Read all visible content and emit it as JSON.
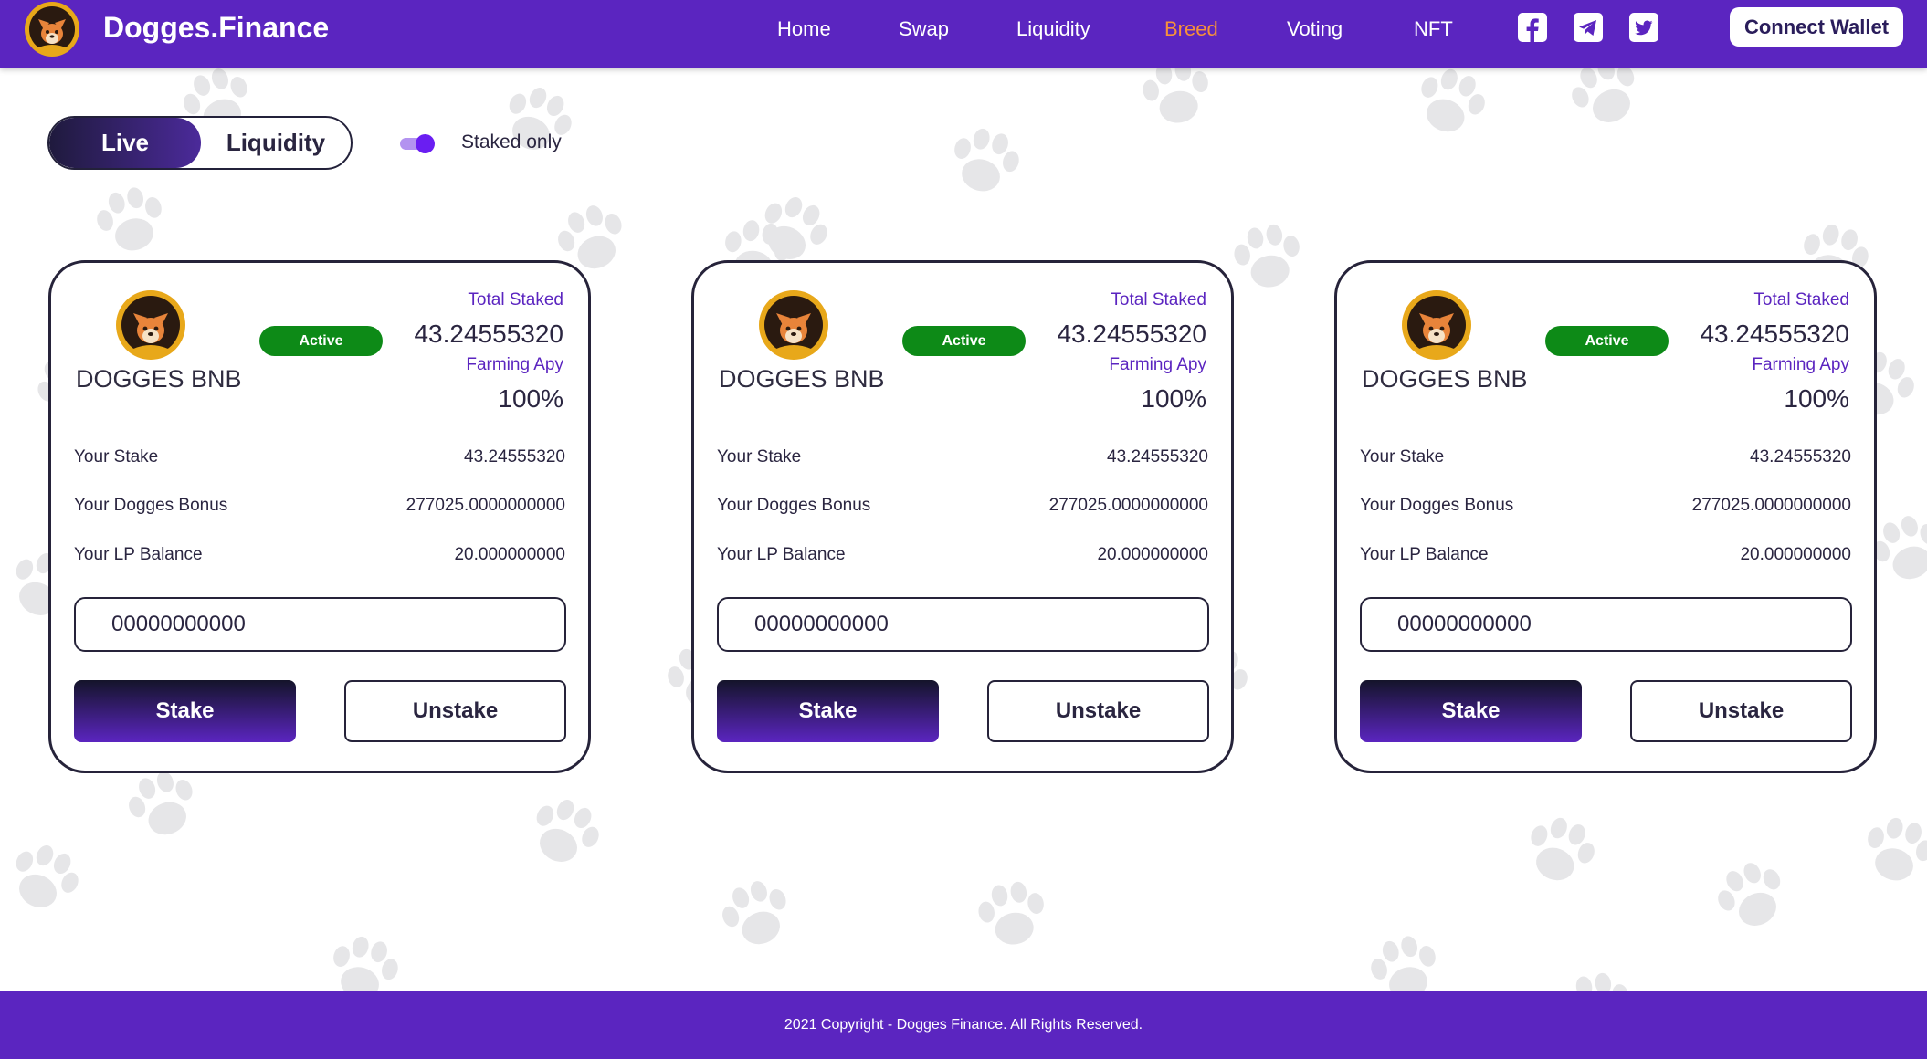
{
  "header": {
    "brand": "Dogges.Finance",
    "nav": [
      {
        "label": "Home"
      },
      {
        "label": "Swap"
      },
      {
        "label": "Liquidity"
      },
      {
        "label": "Breed"
      },
      {
        "label": "Voting"
      },
      {
        "label": "NFT"
      }
    ],
    "active_nav": "Breed",
    "social": [
      "facebook-icon",
      "telegram-icon",
      "twitter-icon"
    ],
    "connect_label": "Connect Wallet"
  },
  "filters": {
    "tabs": [
      "Live",
      "Liquidity"
    ],
    "selected_tab": "Live",
    "toggle_label": "Staked only",
    "toggle_on": true
  },
  "cards": [
    {
      "pair": "DOGGES BNB",
      "status": "Active",
      "total_staked_label": "Total Staked",
      "total_staked": "43.24555320",
      "apy_label": "Farming Apy",
      "apy": "100%",
      "rows": [
        {
          "label": "Your Stake",
          "value": "43.24555320"
        },
        {
          "label": "Your Dogges Bonus",
          "value": "277025.0000000000"
        },
        {
          "label": "Your LP Balance",
          "value": "20.000000000"
        }
      ],
      "input_value": "00000000000",
      "stake_label": "Stake",
      "unstake_label": "Unstake"
    },
    {
      "pair": "DOGGES BNB",
      "status": "Active",
      "total_staked_label": "Total Staked",
      "total_staked": "43.24555320",
      "apy_label": "Farming Apy",
      "apy": "100%",
      "rows": [
        {
          "label": "Your Stake",
          "value": "43.24555320"
        },
        {
          "label": "Your Dogges Bonus",
          "value": "277025.0000000000"
        },
        {
          "label": "Your LP Balance",
          "value": "20.000000000"
        }
      ],
      "input_value": "00000000000",
      "stake_label": "Stake",
      "unstake_label": "Unstake"
    },
    {
      "pair": "DOGGES BNB",
      "status": "Active",
      "total_staked_label": "Total Staked",
      "total_staked": "43.24555320",
      "apy_label": "Farming Apy",
      "apy": "100%",
      "rows": [
        {
          "label": "Your Stake",
          "value": "43.24555320"
        },
        {
          "label": "Your Dogges Bonus",
          "value": "277025.0000000000"
        },
        {
          "label": "Your LP Balance",
          "value": "20.000000000"
        }
      ],
      "input_value": "00000000000",
      "stake_label": "Stake",
      "unstake_label": "Unstake"
    }
  ],
  "footer": {
    "copyright": "2021 Copyright - Dogges Finance. All Rights Reserved."
  },
  "colors": {
    "brand_purple": "#5b25c0",
    "active_nav": "#f7913a",
    "badge_green": "#0d8a17",
    "paw_gray": "#e6e6e8"
  }
}
